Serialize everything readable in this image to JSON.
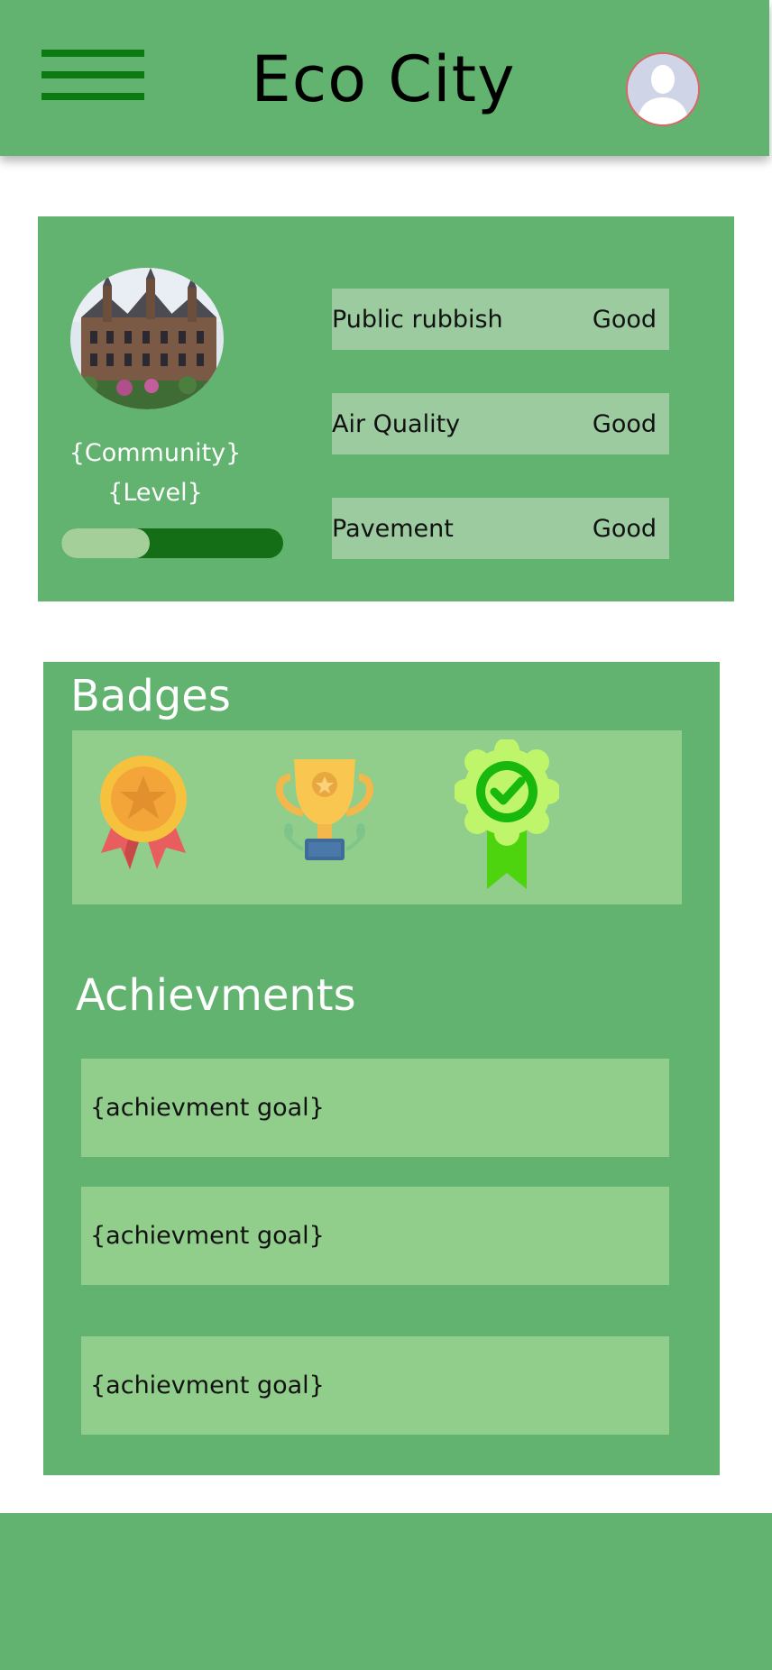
{
  "header": {
    "title": "Eco City",
    "menu_icon": "hamburger-menu-icon",
    "avatar_icon": "user-avatar-icon"
  },
  "community": {
    "name": "{Community}",
    "level": "{Level}",
    "photo": "castle-building-photo",
    "level_progress": 0.4,
    "metrics": [
      {
        "label": "Public rubbish",
        "value": "Good"
      },
      {
        "label": "Air Quality",
        "value": "Good"
      },
      {
        "label": "Pavement",
        "value": "Good"
      }
    ]
  },
  "badges": {
    "title": "Badges",
    "items": [
      {
        "icon": "star-medal-icon"
      },
      {
        "icon": "trophy-icon"
      },
      {
        "icon": "check-ribbon-icon"
      }
    ]
  },
  "achievements": {
    "title": "Achievments",
    "items": [
      {
        "goal": "{achievment goal}"
      },
      {
        "goal": "{achievment goal}"
      },
      {
        "goal": "{achievment goal}"
      }
    ]
  },
  "colors": {
    "primary": "#63b370",
    "menu_green": "#0b7a10",
    "panel_light": "#91cd8b",
    "metric_bg": "#9bcb9f",
    "progress_track": "#146e15",
    "progress_fill": "#a4cf99"
  }
}
